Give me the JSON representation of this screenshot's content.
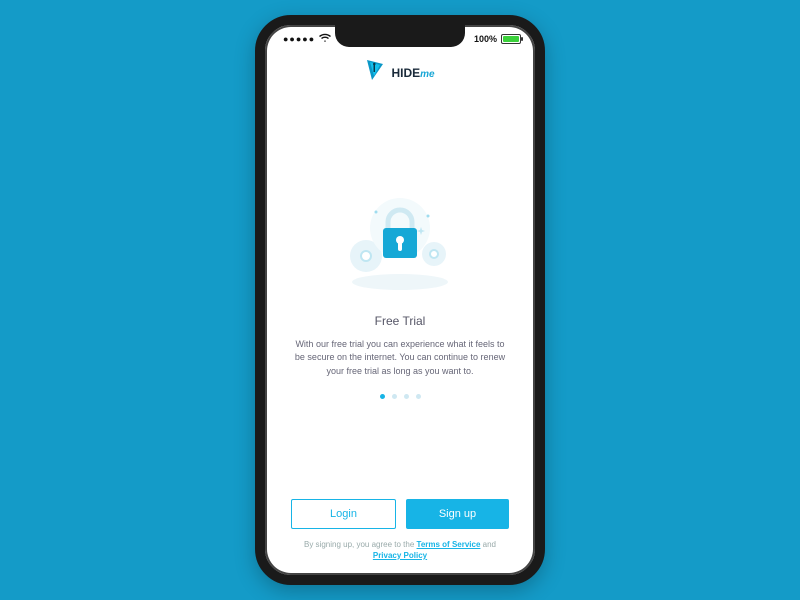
{
  "statusbar": {
    "signal_dots": "●●●●●",
    "battery_pct": "100%"
  },
  "brand": {
    "name": "HIDE",
    "suffix": "me"
  },
  "onboarding": {
    "title": "Free Trial",
    "description": "With our free trial you can experience what it feels to be secure on the internet. You can continue to renew your free trial as long as you want to.",
    "page_index": 0,
    "page_count": 4
  },
  "cta": {
    "login": "Login",
    "signup": "Sign up"
  },
  "legal": {
    "prefix": "By signing up, you agree to the ",
    "terms": "Terms of Service",
    "middle": " and ",
    "privacy": "Privacy Policy"
  }
}
